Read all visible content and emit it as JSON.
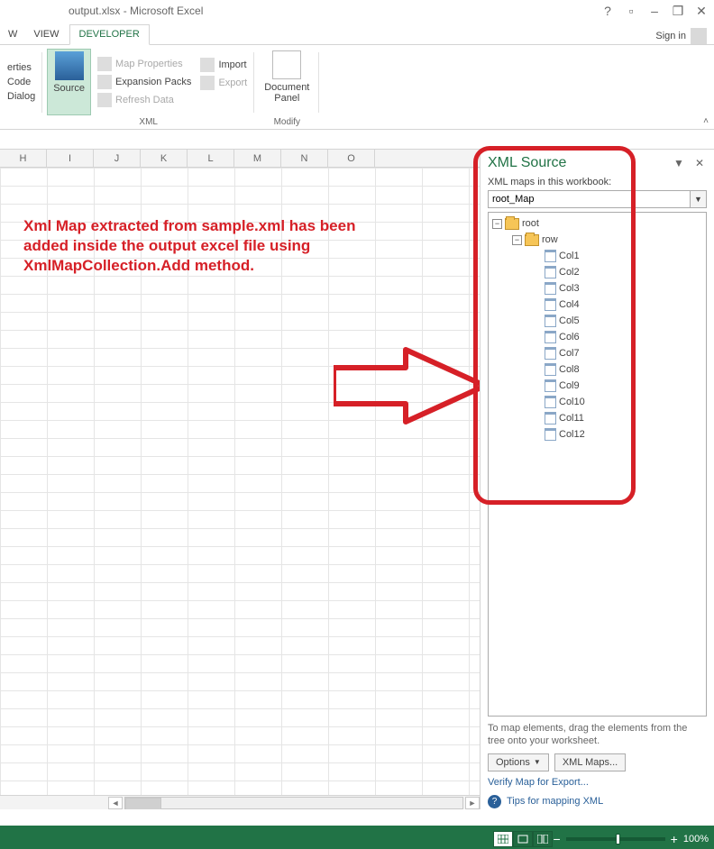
{
  "window": {
    "title": "output.xlsx - Microsoft Excel",
    "signin": "Sign in"
  },
  "tabs": {
    "view_part": "W",
    "view": "VIEW",
    "developer": "DEVELOPER"
  },
  "ribbon": {
    "group0": {
      "erties": "erties",
      "code": "Code",
      "dialog": "Dialog"
    },
    "source_btn": "Source",
    "map_properties": "Map Properties",
    "expansion_packs": "Expansion Packs",
    "refresh_data": "Refresh Data",
    "import": "Import",
    "export": "Export",
    "xml_group": "XML",
    "doc_panel": "Document\nPanel",
    "modify_group": "Modify"
  },
  "columns": [
    "H",
    "I",
    "J",
    "K",
    "L",
    "M",
    "N",
    "O"
  ],
  "annotation": "Xml Map extracted from sample.xml has been added inside the output excel file using XmlMapCollection.Add method.",
  "pane": {
    "title": "XML Source",
    "maps_label": "XML maps in this workbook:",
    "selected_map": "root_Map",
    "tree_root": "root",
    "tree_row": "row",
    "cols": [
      "Col1",
      "Col2",
      "Col3",
      "Col4",
      "Col5",
      "Col6",
      "Col7",
      "Col8",
      "Col9",
      "Col10",
      "Col11",
      "Col12"
    ],
    "hint": "To map elements, drag the elements from the tree onto your worksheet.",
    "options": "Options",
    "xml_maps": "XML Maps...",
    "verify": "Verify Map for Export...",
    "tips": "Tips for mapping XML"
  },
  "status": {
    "zoom": "100%"
  }
}
